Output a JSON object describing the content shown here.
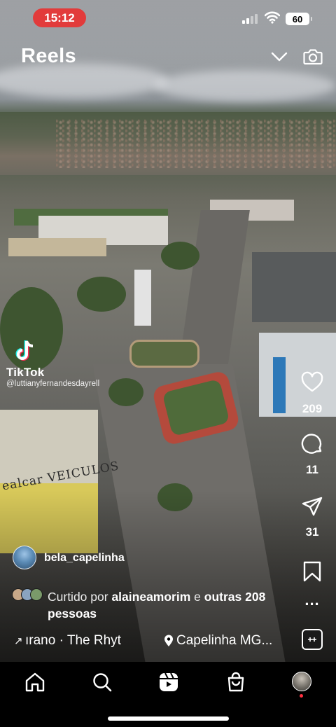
{
  "status_bar": {
    "time": "15:12",
    "battery": "60"
  },
  "header": {
    "title": "Reels",
    "chevron_icon": "chevron-down-icon",
    "camera_icon": "camera-icon"
  },
  "video": {
    "watermark_brand": "TikTok",
    "watermark_handle": "@luttianyfernandesdayrell",
    "sign_text": "ealcar VEICULOS"
  },
  "actions": {
    "likes": "209",
    "comments": "11",
    "shares": "31"
  },
  "post": {
    "username": "bela_capelinha",
    "liked_prefix": "Curtido por",
    "liked_user": "alaineamorim",
    "liked_conj": "e",
    "liked_others": "outras 208 pessoas",
    "music": "ırano · The Rhyt",
    "location": "Capelinha MG..."
  },
  "nav": {
    "items": [
      "home-icon",
      "search-icon",
      "reels-icon",
      "shop-icon",
      "profile-avatar"
    ]
  },
  "colors": {
    "time_pill": "#e23b3b",
    "notification_dot": "#ff3040"
  }
}
